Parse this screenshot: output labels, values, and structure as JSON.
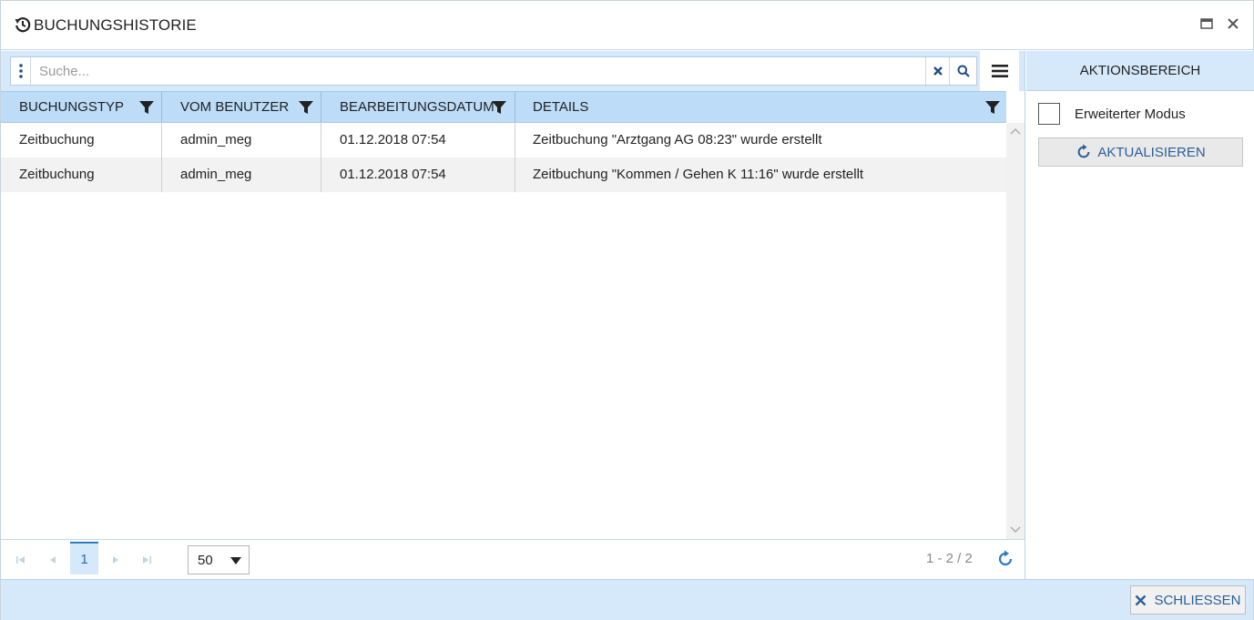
{
  "window": {
    "title": "BUCHUNGSHISTORIE"
  },
  "search": {
    "placeholder": "Suche...",
    "value": ""
  },
  "grid": {
    "columns": [
      "BUCHUNGSTYP",
      "VOM BENUTZER",
      "BEARBEITUNGSDATUM",
      "DETAILS"
    ],
    "rows": [
      [
        "Zeitbuchung",
        "admin_meg",
        "01.12.2018 07:54",
        "Zeitbuchung \"Arztgang AG 08:23\" wurde erstellt"
      ],
      [
        "Zeitbuchung",
        "admin_meg",
        "01.12.2018 07:54",
        "Zeitbuchung \"Kommen / Gehen K 11:16\" wurde erstellt"
      ]
    ]
  },
  "pager": {
    "current_page": "1",
    "page_size": "50",
    "info": "1 - 2 / 2"
  },
  "actions": {
    "header": "AKTIONSBEREICH",
    "extended_mode_label": "Erweiterter Modus",
    "refresh_label": "AKTUALISIEREN"
  },
  "footer": {
    "close_label": "SCHLIESSEN"
  },
  "colors": {
    "accent": "#2b7bc2",
    "header_bg": "#bcdcf8",
    "toolbar_bg": "#d6e9fb"
  },
  "icons": {
    "title": "history-icon",
    "maximize": "maximize-icon",
    "close": "close-icon",
    "kebab": "kebab-menu-icon",
    "clear": "clear-icon",
    "search": "search-icon",
    "menu": "hamburger-menu-icon",
    "filter": "filter-icon",
    "refresh": "refresh-icon"
  }
}
